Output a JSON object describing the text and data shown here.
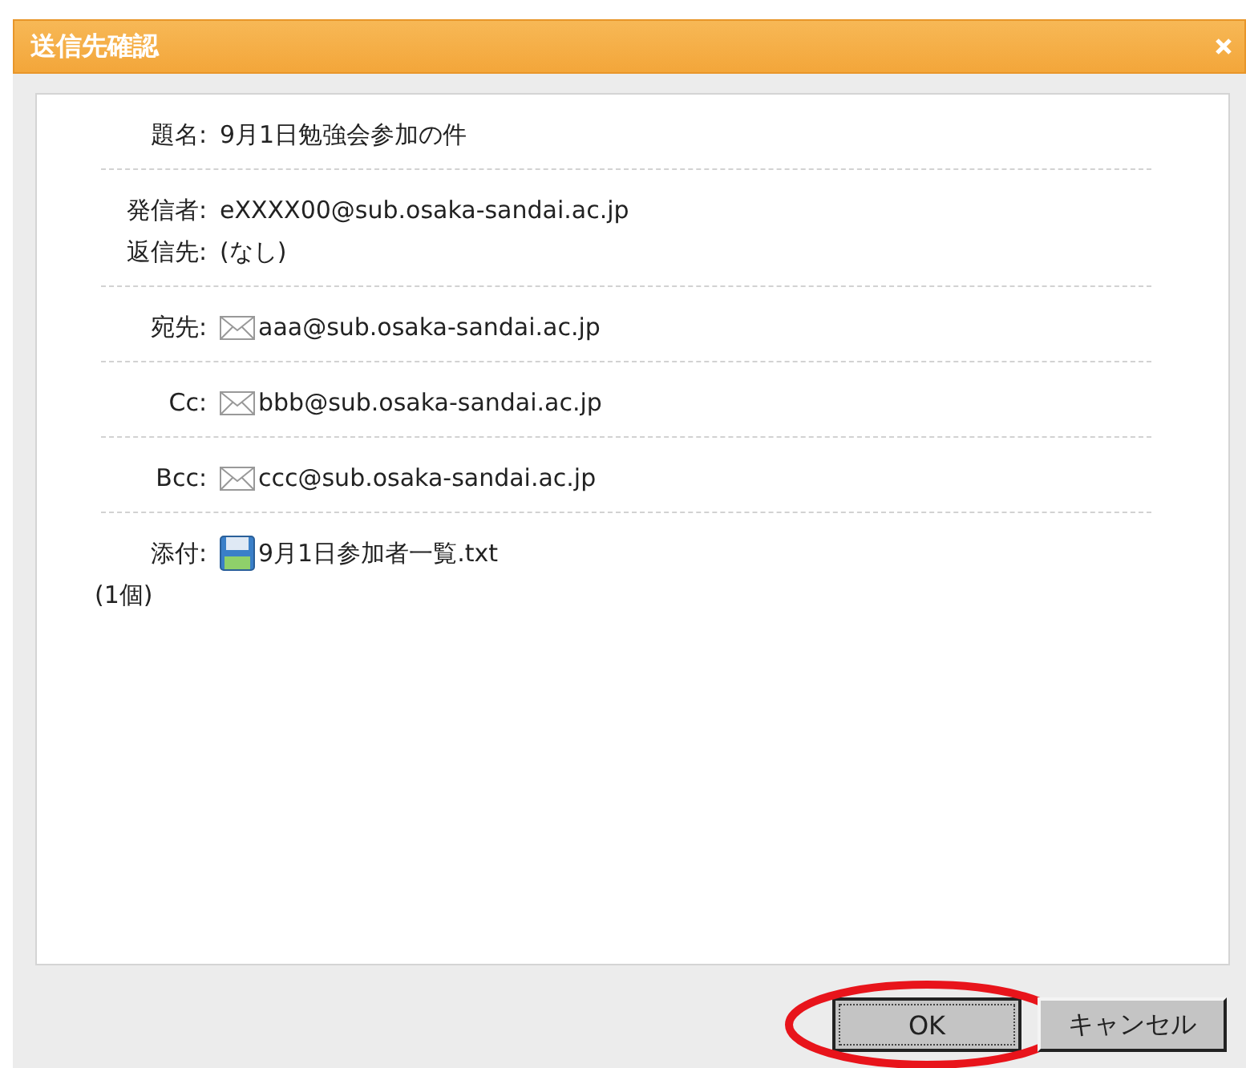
{
  "dialog": {
    "title": "送信先確認"
  },
  "groups": [
    {
      "fields": [
        {
          "label": "題名:",
          "kind": "text",
          "value": "9月1日勉強会参加の件"
        }
      ]
    },
    {
      "fields": [
        {
          "label": "発信者:",
          "kind": "text",
          "value": "eXXXX00@sub.osaka-sandai.ac.jp"
        },
        {
          "label": "返信先:",
          "kind": "text",
          "value": "(なし)"
        }
      ]
    },
    {
      "fields": [
        {
          "label": "宛先:",
          "kind": "email",
          "value": "aaa@sub.osaka-sandai.ac.jp"
        }
      ]
    },
    {
      "fields": [
        {
          "label": "Cc:",
          "kind": "email",
          "value": "bbb@sub.osaka-sandai.ac.jp"
        }
      ]
    },
    {
      "fields": [
        {
          "label": "Bcc:",
          "kind": "email",
          "value": "ccc@sub.osaka-sandai.ac.jp"
        }
      ]
    },
    {
      "fields": [
        {
          "label": "添付:",
          "kind": "file",
          "value": "9月1日参加者一覧.txt",
          "note": "(1個)"
        }
      ]
    }
  ],
  "buttons": [
    {
      "label": "OK",
      "focused": true,
      "circled": true
    },
    {
      "label": "キャンセル",
      "focused": false,
      "circled": false
    }
  ]
}
